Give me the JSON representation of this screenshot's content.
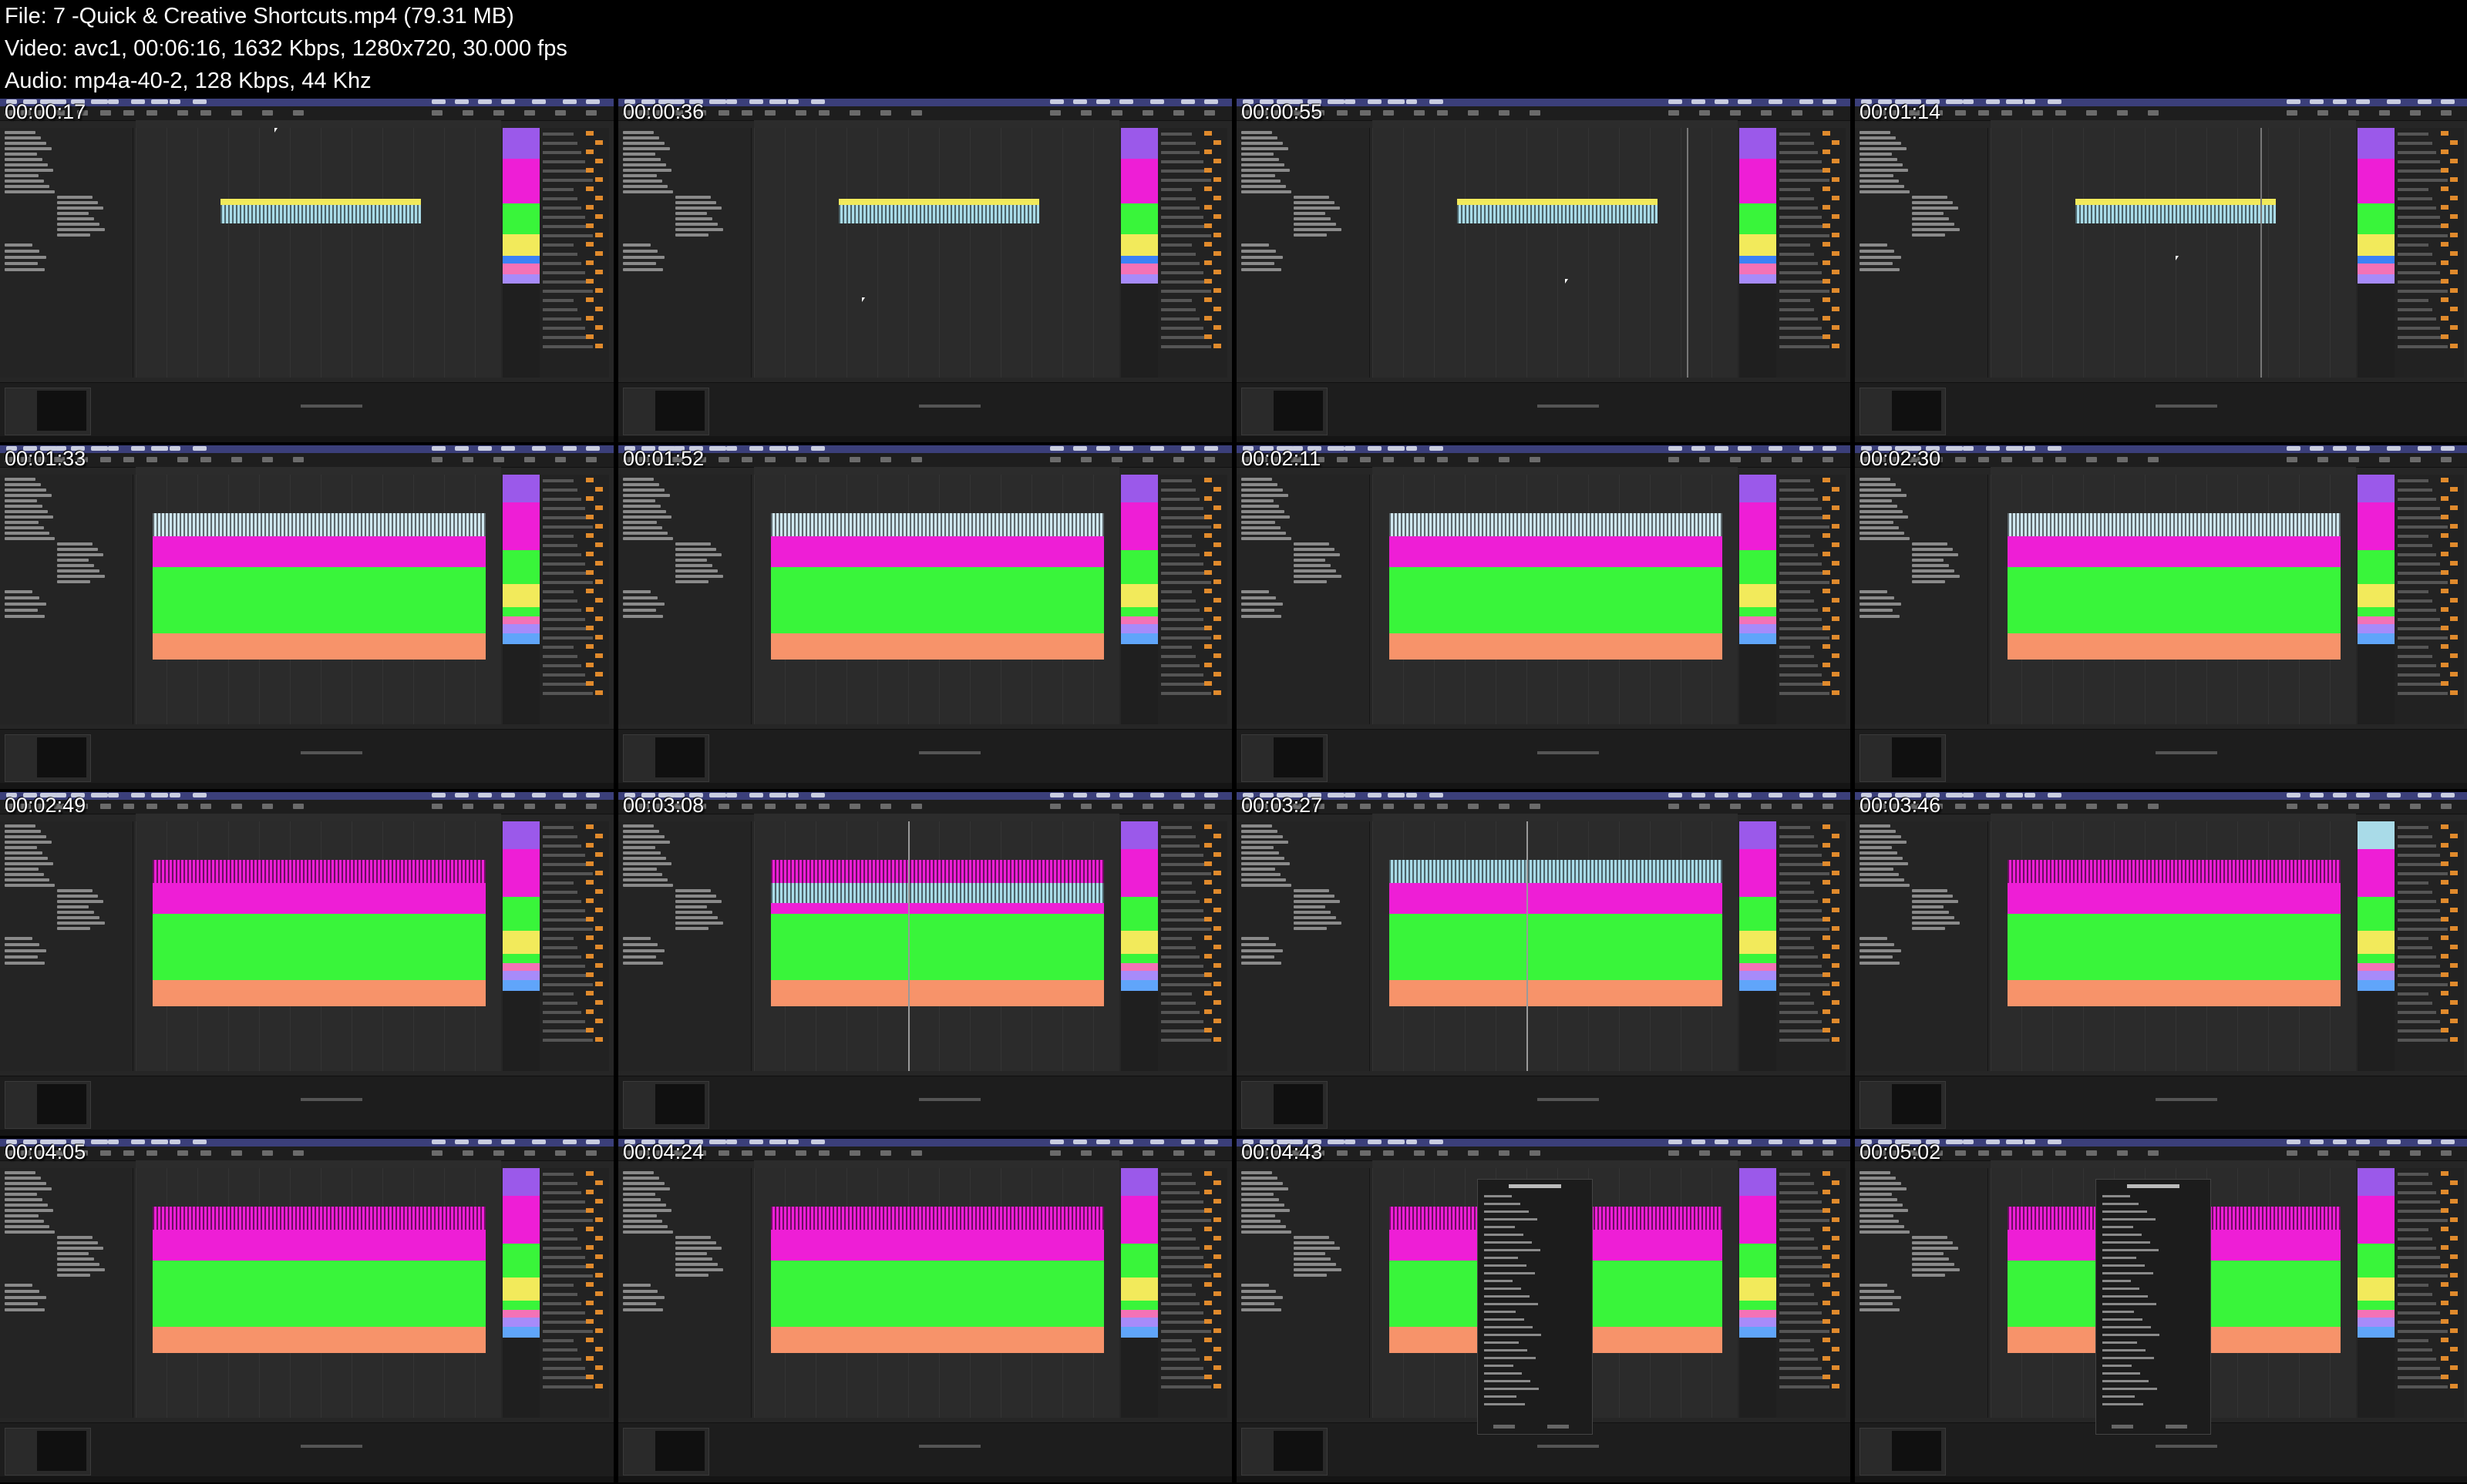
{
  "info": {
    "line1": "File: 7 -Quick & Creative Shortcuts.mp4 (79.31 MB)",
    "line2": "Video: avc1, 00:06:16, 1632 Kbps, 1280x720, 30.000 fps",
    "line3": "Audio: mp4a-40-2, 128 Kbps, 44 Khz"
  },
  "colors": {
    "yellow": "#f2ea5b",
    "lightblue": "#a9dbe8",
    "magenta": "#ee1ed6",
    "green": "#39f53a",
    "salmon": "#f7936a",
    "purple": "#9b59ea",
    "menubar": "#3b3f7a",
    "background": "#262626"
  },
  "thumbnails": [
    {
      "timestamp": "00:00:17",
      "scene": "single-clip"
    },
    {
      "timestamp": "00:00:36",
      "scene": "single-clip"
    },
    {
      "timestamp": "00:00:55",
      "scene": "single-clip"
    },
    {
      "timestamp": "00:01:14",
      "scene": "single-clip"
    },
    {
      "timestamp": "00:01:33",
      "scene": "full-arrangement"
    },
    {
      "timestamp": "00:01:52",
      "scene": "full-arrangement"
    },
    {
      "timestamp": "00:02:11",
      "scene": "full-arrangement"
    },
    {
      "timestamp": "00:02:30",
      "scene": "full-arrangement"
    },
    {
      "timestamp": "00:02:49",
      "scene": "full-arrangement"
    },
    {
      "timestamp": "00:03:08",
      "scene": "full-arrangement-selected"
    },
    {
      "timestamp": "00:03:27",
      "scene": "full-arrangement-selected"
    },
    {
      "timestamp": "00:03:46",
      "scene": "full-arrangement"
    },
    {
      "timestamp": "00:04:05",
      "scene": "full-arrangement"
    },
    {
      "timestamp": "00:04:24",
      "scene": "full-arrangement"
    },
    {
      "timestamp": "00:04:43",
      "scene": "export-dialog"
    },
    {
      "timestamp": "00:05:02",
      "scene": "export-dialog"
    }
  ]
}
